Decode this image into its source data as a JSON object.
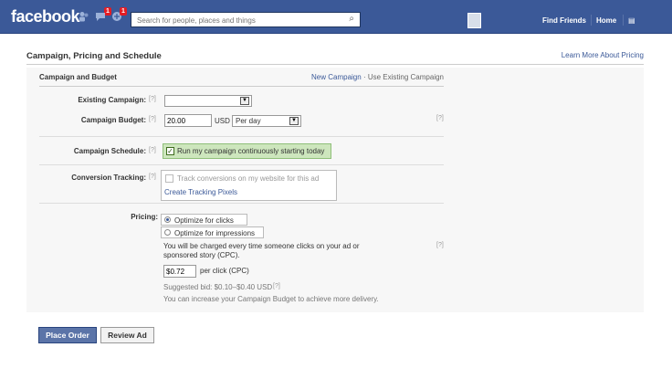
{
  "header": {
    "logo": "facebook",
    "requests_badge": "1",
    "messages_badge": "1",
    "search_placeholder": "Search for people, places and things",
    "nav": [
      "Find Friends",
      "Home"
    ]
  },
  "page": {
    "title": "Campaign, Pricing and Schedule",
    "learn_more": "Learn More About Pricing"
  },
  "budget_section": {
    "title": "Campaign and Budget",
    "new_campaign": "New Campaign",
    "separator": "·",
    "use_existing": "Use Existing Campaign"
  },
  "help_marker": "[?]",
  "existing_campaign": {
    "label": "Existing Campaign:",
    "value": ""
  },
  "campaign_budget": {
    "label": "Campaign Budget:",
    "value": "20.00",
    "currency": "USD",
    "period": "Per day"
  },
  "schedule": {
    "label": "Campaign Schedule:",
    "option": "Run my campaign continuously starting today",
    "checked": true
  },
  "conversion": {
    "label": "Conversion Tracking:",
    "option": "Track conversions on my website for this ad",
    "link": "Create Tracking Pixels"
  },
  "pricing": {
    "label": "Pricing:",
    "option_clicks": "Optimize for clicks",
    "option_impressions": "Optimize for impressions",
    "charge_line1": "You will be charged every time someone clicks on your ad or",
    "charge_line2": "sponsored story (CPC).",
    "bid": "$0.72",
    "bid_unit": "per click (CPC)",
    "suggested": "Suggested bid: $0.10–$0.40 USD",
    "increase_note": "You can increase your Campaign Budget to achieve more delivery."
  },
  "actions": {
    "place_order": "Place Order",
    "review_ad": "Review Ad"
  },
  "colors": {
    "brand": "#3b5998",
    "schedule_highlight": "#cde6bd",
    "panel_bg": "#f7f7f7"
  }
}
